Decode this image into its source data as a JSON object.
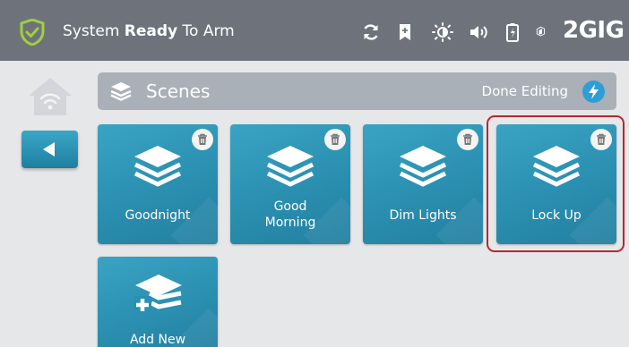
{
  "status": {
    "prefix": "System ",
    "bold": "Ready",
    "suffix": " To Arm"
  },
  "brand": {
    "logo_text": "2GIG"
  },
  "header": {
    "title": "Scenes",
    "done_label": "Done Editing"
  },
  "tiles": [
    {
      "line1": "Goodnight",
      "line2": ""
    },
    {
      "line1": "Good",
      "line2": "Morning"
    },
    {
      "line1": "Dim Lights",
      "line2": ""
    },
    {
      "line1": "Lock Up",
      "line2": ""
    }
  ],
  "add_tile": {
    "label": "Add New"
  },
  "colors": {
    "topbar": "#6e737b",
    "tile": "#2a8fb0",
    "highlight": "#b6282e",
    "accent": "#2e9ed6"
  },
  "icons": [
    "shield-check-icon",
    "sync-icon",
    "bookmark-icon",
    "brightness-icon",
    "volume-icon",
    "battery-icon",
    "home-wifi-icon",
    "back-arrow-icon",
    "layers-icon",
    "bolt-icon",
    "trash-icon",
    "add-layers-icon"
  ]
}
